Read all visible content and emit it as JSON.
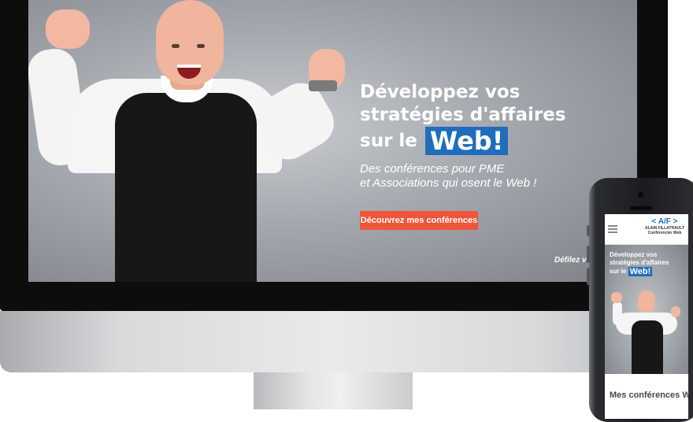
{
  "desktop": {
    "hero": {
      "title_line1": "Développez vos",
      "title_line2": "stratégies d'affaires",
      "title_line3_prefix": "sur le",
      "title_highlight": "Web!",
      "subtitle_line1": "Des conférences pour PME",
      "subtitle_line2": "et Associations qui osent le Web !",
      "cta_label": "Découvrez mes conférences",
      "scroll_hint": "Défilez vers l"
    }
  },
  "mobile": {
    "logo": {
      "mark": "< A/F >",
      "name": "ALAIN FILLATRAULT",
      "tagline": "Conférencier Web"
    },
    "hero": {
      "title_line1": "Développez vos",
      "title_line2": "stratégies d'affaires",
      "title_line3_prefix": "sur le",
      "title_highlight": "Web!"
    },
    "section_heading": "Mes conférences W"
  },
  "colors": {
    "accent_blue": "#1f6dbb",
    "cta_orange": "#f0553a",
    "hero_gray": "#a3a8ae"
  }
}
